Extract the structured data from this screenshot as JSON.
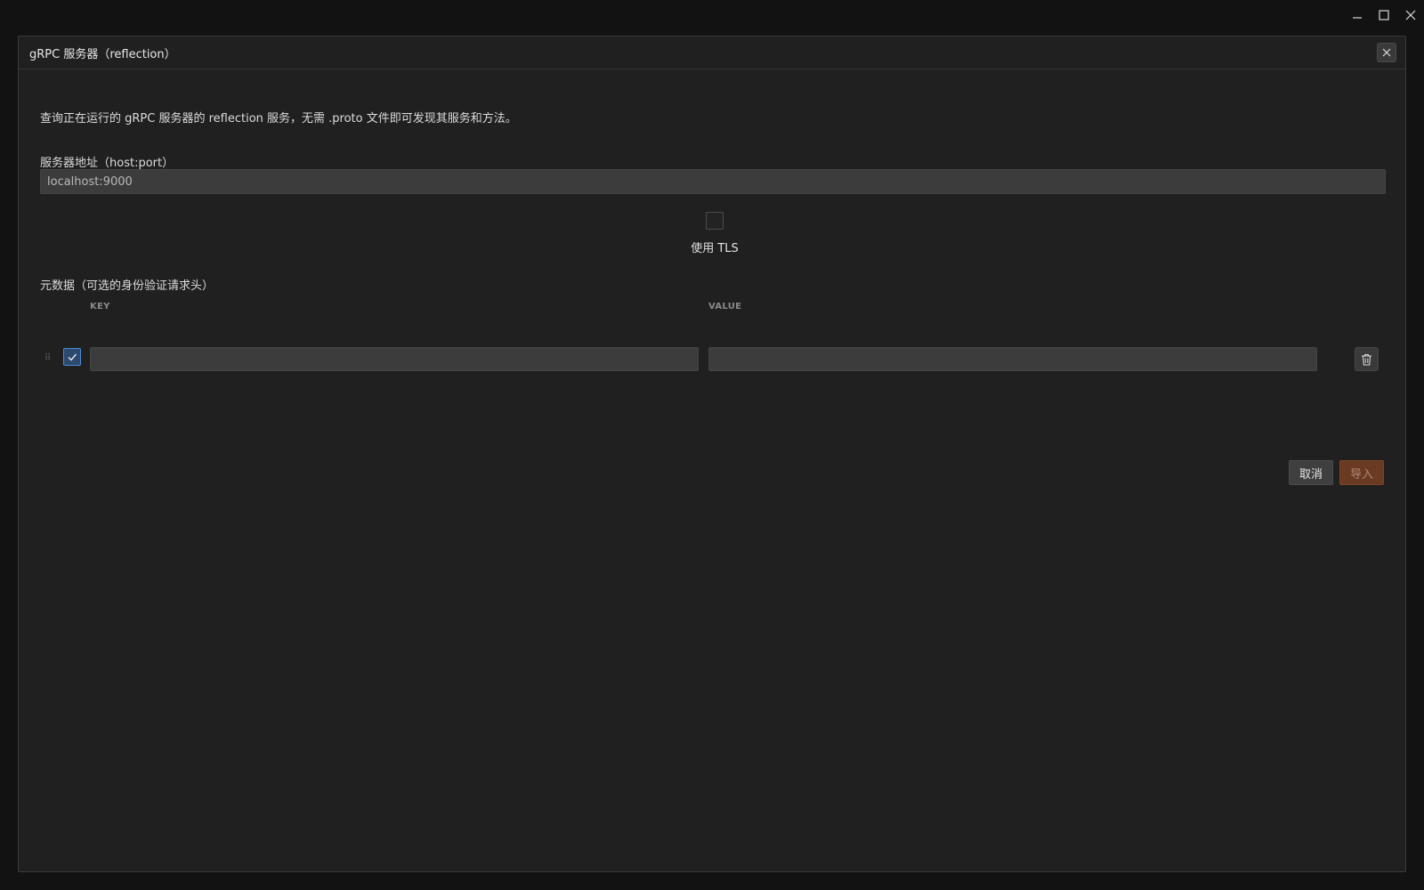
{
  "window_controls": {
    "minimize": "minimize-icon",
    "maximize": "maximize-icon",
    "close": "close-icon"
  },
  "dialog": {
    "title": "gRPC 服务器（reflection）",
    "description": "查询正在运行的 gRPC 服务器的 reflection 服务，无需 .proto 文件即可发现其服务和方法。",
    "address": {
      "label": "服务器地址（host:port）",
      "value": "localhost:9000"
    },
    "tls": {
      "label": "使用 TLS",
      "checked": false
    },
    "metadata": {
      "label": "元数据（可选的身份验证请求头）",
      "columns": {
        "key": "KEY",
        "value": "VALUE"
      },
      "rows": [
        {
          "enabled": true,
          "key": "",
          "value": ""
        }
      ]
    },
    "buttons": {
      "cancel": "取消",
      "import": "导入"
    }
  },
  "colors": {
    "dialog_bg": "#202020",
    "input_bg": "#3c3c3c",
    "accent_import": "#6a3a22",
    "checkbox_accent": "#4c8ad6"
  }
}
